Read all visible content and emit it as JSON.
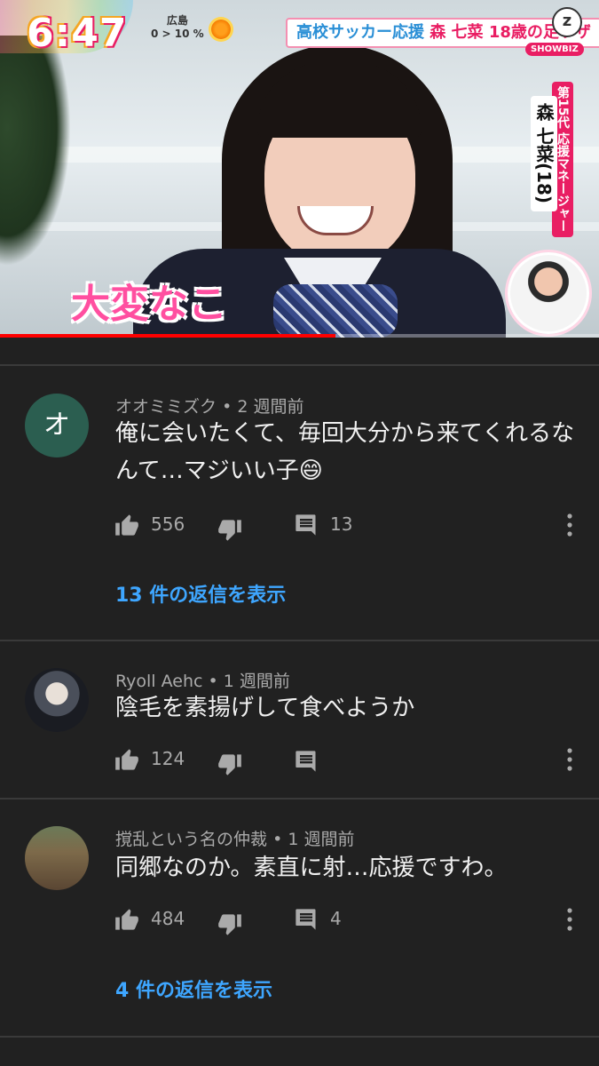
{
  "video": {
    "clock": "6:47",
    "weather_city": "広島",
    "weather_percent": "0 > 10 %",
    "headline_blue": "高校サッカー応援",
    "headline_pink": "森 七菜 18歳の足ワザ",
    "showbiz_label": "SHOWBIZ",
    "badge_role": "第15代 応援マネージャー",
    "badge_name": "森 七菜(18)",
    "caption": "大変なこ",
    "progress": 0.56
  },
  "comments": [
    {
      "avatar_letter": "オ",
      "author": "オオミミズク",
      "time": "2 週間前",
      "text": "俺に会いたくて、毎回大分から来てくれるなんて…マジいい子😄",
      "likes": "556",
      "reply_count": "13",
      "view_replies": "13 件の返信を表示"
    },
    {
      "avatar_letter": "",
      "author": "Ryoll Aehc",
      "time": "1 週間前",
      "text": "陰毛を素揚げして食べようか",
      "likes": "124",
      "reply_count": "",
      "view_replies": ""
    },
    {
      "avatar_letter": "",
      "author": "撹乱という名の仲裁",
      "time": "1 週間前",
      "text": "同郷なのか。素直に射…応援ですわ。",
      "likes": "484",
      "reply_count": "4",
      "view_replies": "4 件の返信を表示"
    }
  ],
  "colors": {
    "background": "#212121",
    "link": "#3ea6ff",
    "progress": "#ff0000"
  }
}
